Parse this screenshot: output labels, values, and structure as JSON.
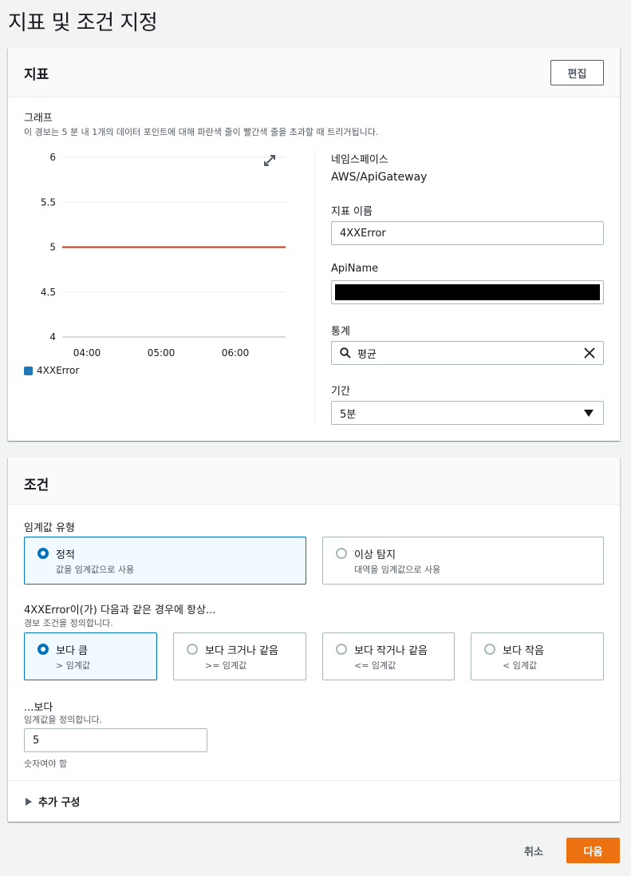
{
  "page": {
    "title": "지표 및 조건 지정"
  },
  "metric_panel": {
    "title": "지표",
    "edit_label": "편집",
    "graph_label": "그래프",
    "graph_desc": "이 경보는 5 분 내 1개의 데이터 포인트에 대해 파란색 줄이 빨간색 줄을 초과할 때 트리거됩니다.",
    "legend_label": "4XXError",
    "namespace_label": "네임스페이스",
    "namespace_value": "AWS/ApiGateway",
    "metric_name_label": "지표 이름",
    "metric_name_value": "4XXError",
    "apiname_label": "ApiName",
    "stat_label": "통계",
    "stat_value": "평균",
    "period_label": "기간",
    "period_value": "5분"
  },
  "chart_data": {
    "type": "line",
    "x_ticks": [
      "04:00",
      "05:00",
      "06:00"
    ],
    "y_ticks": [
      "6",
      "5.5",
      "5",
      "4.5",
      "4"
    ],
    "ylim": [
      4,
      6
    ],
    "grid": true,
    "legend": "bottom-left",
    "series": [
      {
        "name": "4XXError",
        "color": "#1f77b4",
        "values": []
      }
    ],
    "threshold": {
      "value": 5,
      "color": "#d13212"
    }
  },
  "conditions_panel": {
    "title": "조건",
    "threshold_type_label": "임계값 유형",
    "threshold_types": [
      {
        "label": "정적",
        "desc": "값을 임계값으로 사용",
        "selected": true
      },
      {
        "label": "이상 탐지",
        "desc": "대역을 임계값으로 사용",
        "selected": false
      }
    ],
    "whenever_label": "4XXError이(가) 다음과 같은 경우에 항상...",
    "whenever_desc": "경보 조건을 정의합니다.",
    "operators": [
      {
        "label": "보다 큼",
        "desc": "> 임계값",
        "selected": true
      },
      {
        "label": "보다 크거나 같음",
        "desc": ">= 임계값",
        "selected": false
      },
      {
        "label": "보다 작거나 같음",
        "desc": "<= 임계값",
        "selected": false
      },
      {
        "label": "보다 작음",
        "desc": "< 임계값",
        "selected": false
      }
    ],
    "than_label": "...보다",
    "than_desc": "임계값을 정의합니다.",
    "threshold_value": "5",
    "threshold_hint": "숫자여야 함",
    "additional_config_label": "추가 구성"
  },
  "footer": {
    "cancel_label": "취소",
    "next_label": "다음"
  },
  "colors": {
    "accent": "#0073bb",
    "primary_button": "#ec7211",
    "threshold_line": "#d13212"
  }
}
